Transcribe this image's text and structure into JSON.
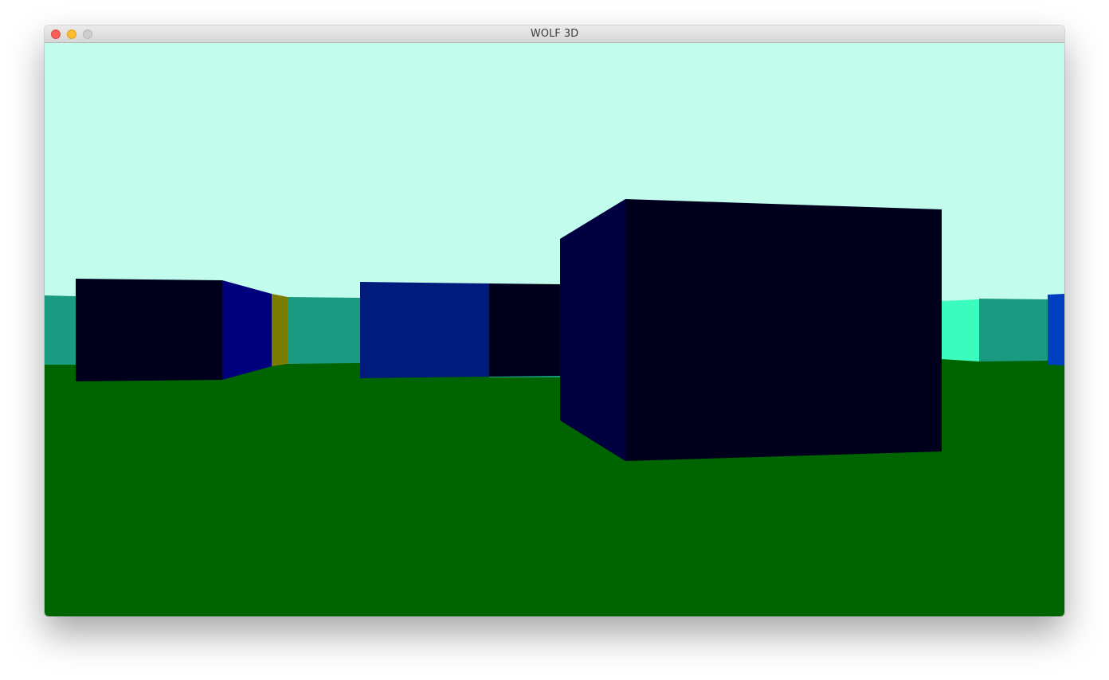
{
  "window": {
    "title": "WOLF 3D",
    "controls": [
      "close-button",
      "minimize-button",
      "zoom-button"
    ]
  },
  "scene": {
    "ceiling_color": "#c2fcec",
    "floor_color": "#006400",
    "wall_colors": {
      "teal": "#1a9a80",
      "aqua": "#3cfcbd",
      "black_navy": "#00001d",
      "dark_navy": "#000040",
      "navy": "#00007c",
      "mid_blue": "#001b7c",
      "bright_blue": "#0040c0",
      "olive": "#7c7c00"
    }
  }
}
